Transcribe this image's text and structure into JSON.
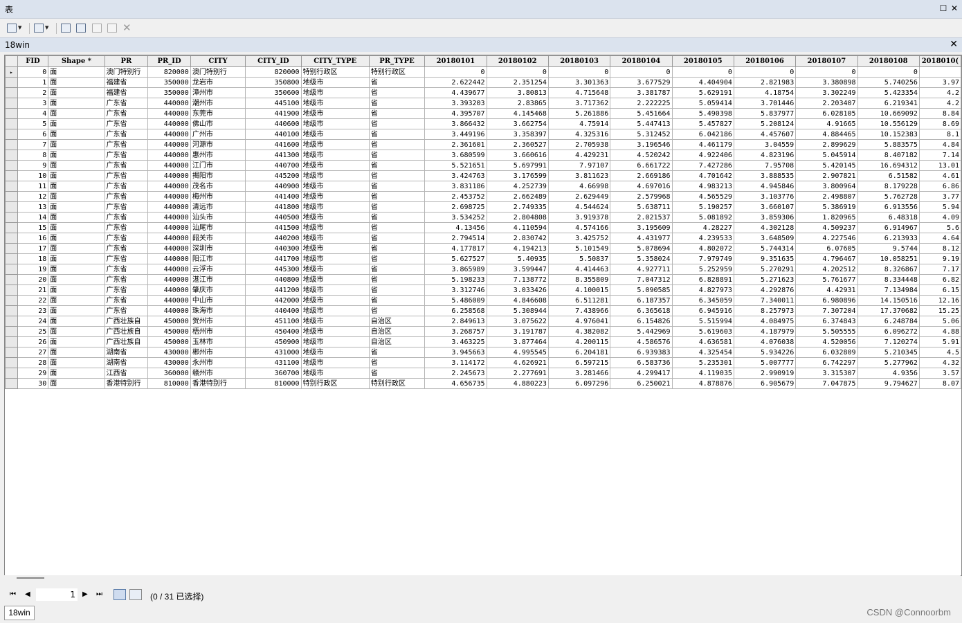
{
  "window": {
    "title": "表"
  },
  "table_tab": {
    "title": "18win"
  },
  "columns": [
    "FID",
    "Shape *",
    "PR",
    "PR_ID",
    "CITY",
    "CITY_ID",
    "CITY_TYPE",
    "PR_TYPE",
    "20180101",
    "20180102",
    "20180103",
    "20180104",
    "20180105",
    "20180106",
    "20180107",
    "20180108",
    "2018010("
  ],
  "rows": [
    [
      "0",
      "面",
      "澳门特别行",
      "820000",
      "澳门特别行",
      "820000",
      "特别行政区",
      "特别行政区",
      "0",
      "0",
      "0",
      "0",
      "0",
      "0",
      "0",
      "0",
      ""
    ],
    [
      "1",
      "面",
      "福建省",
      "350000",
      "龙岩市",
      "350800",
      "地级市",
      "省",
      "2.622442",
      "2.351254",
      "3.301363",
      "3.677529",
      "4.404904",
      "2.821983",
      "3.380898",
      "5.740256",
      "3.97"
    ],
    [
      "2",
      "面",
      "福建省",
      "350000",
      "漳州市",
      "350600",
      "地级市",
      "省",
      "4.439677",
      "3.80813",
      "4.715648",
      "3.381787",
      "5.629191",
      "4.18754",
      "3.302249",
      "5.423354",
      "4.2"
    ],
    [
      "3",
      "面",
      "广东省",
      "440000",
      "潮州市",
      "445100",
      "地级市",
      "省",
      "3.393203",
      "2.83865",
      "3.717362",
      "2.222225",
      "5.059414",
      "3.701446",
      "2.203407",
      "6.219341",
      "4.2"
    ],
    [
      "4",
      "面",
      "广东省",
      "440000",
      "东莞市",
      "441900",
      "地级市",
      "省",
      "4.395707",
      "4.145468",
      "5.261886",
      "5.451664",
      "5.490398",
      "5.837977",
      "6.028105",
      "10.669092",
      "8.84"
    ],
    [
      "5",
      "面",
      "广东省",
      "440000",
      "佛山市",
      "440600",
      "地级市",
      "省",
      "3.866432",
      "3.662754",
      "4.75914",
      "5.447413",
      "5.457827",
      "5.208124",
      "4.91665",
      "10.556129",
      "8.69"
    ],
    [
      "6",
      "面",
      "广东省",
      "440000",
      "广州市",
      "440100",
      "地级市",
      "省",
      "3.449196",
      "3.358397",
      "4.325316",
      "5.312452",
      "6.042186",
      "4.457607",
      "4.884465",
      "10.152383",
      "8.1"
    ],
    [
      "7",
      "面",
      "广东省",
      "440000",
      "河源市",
      "441600",
      "地级市",
      "省",
      "2.361601",
      "2.360527",
      "2.705938",
      "3.196546",
      "4.461179",
      "3.04559",
      "2.899629",
      "5.883575",
      "4.84"
    ],
    [
      "8",
      "面",
      "广东省",
      "440000",
      "惠州市",
      "441300",
      "地级市",
      "省",
      "3.680599",
      "3.660616",
      "4.429231",
      "4.520242",
      "4.922406",
      "4.823196",
      "5.045914",
      "8.407182",
      "7.14"
    ],
    [
      "9",
      "面",
      "广东省",
      "440000",
      "江门市",
      "440700",
      "地级市",
      "省",
      "5.521651",
      "5.697991",
      "7.97107",
      "6.661722",
      "7.427286",
      "7.95708",
      "5.420145",
      "16.694312",
      "13.01"
    ],
    [
      "10",
      "面",
      "广东省",
      "440000",
      "揭阳市",
      "445200",
      "地级市",
      "省",
      "3.424763",
      "3.176599",
      "3.811623",
      "2.669186",
      "4.701642",
      "3.888535",
      "2.907821",
      "6.51582",
      "4.61"
    ],
    [
      "11",
      "面",
      "广东省",
      "440000",
      "茂名市",
      "440900",
      "地级市",
      "省",
      "3.831186",
      "4.252739",
      "4.66998",
      "4.697016",
      "4.983213",
      "4.945846",
      "3.800964",
      "8.179228",
      "6.86"
    ],
    [
      "12",
      "面",
      "广东省",
      "440000",
      "梅州市",
      "441400",
      "地级市",
      "省",
      "2.453752",
      "2.662489",
      "2.629449",
      "2.579968",
      "4.565529",
      "3.103776",
      "2.498807",
      "5.762728",
      "3.77"
    ],
    [
      "13",
      "面",
      "广东省",
      "440000",
      "清远市",
      "441800",
      "地级市",
      "省",
      "2.698725",
      "2.749335",
      "4.544624",
      "5.638711",
      "5.190257",
      "3.660107",
      "5.386919",
      "6.913556",
      "5.94"
    ],
    [
      "14",
      "面",
      "广东省",
      "440000",
      "汕头市",
      "440500",
      "地级市",
      "省",
      "3.534252",
      "2.804808",
      "3.919378",
      "2.021537",
      "5.081892",
      "3.859306",
      "1.820965",
      "6.48318",
      "4.09"
    ],
    [
      "15",
      "面",
      "广东省",
      "440000",
      "汕尾市",
      "441500",
      "地级市",
      "省",
      "4.13456",
      "4.110594",
      "4.574166",
      "3.195609",
      "4.28227",
      "4.302128",
      "4.509237",
      "6.914967",
      "5.6"
    ],
    [
      "16",
      "面",
      "广东省",
      "440000",
      "韶关市",
      "440200",
      "地级市",
      "省",
      "2.794514",
      "2.830742",
      "3.425752",
      "4.431977",
      "4.239533",
      "3.648509",
      "4.227546",
      "6.213933",
      "4.64"
    ],
    [
      "17",
      "面",
      "广东省",
      "440000",
      "深圳市",
      "440300",
      "地级市",
      "省",
      "4.177817",
      "4.194213",
      "5.101549",
      "5.078694",
      "4.802072",
      "5.744314",
      "6.07605",
      "9.5744",
      "8.12"
    ],
    [
      "18",
      "面",
      "广东省",
      "440000",
      "阳江市",
      "441700",
      "地级市",
      "省",
      "5.627527",
      "5.40935",
      "5.50837",
      "5.358024",
      "7.979749",
      "9.351635",
      "4.796467",
      "10.058251",
      "9.19"
    ],
    [
      "19",
      "面",
      "广东省",
      "440000",
      "云浮市",
      "445300",
      "地级市",
      "省",
      "3.865989",
      "3.599447",
      "4.414463",
      "4.927711",
      "5.252959",
      "5.270291",
      "4.202512",
      "8.326867",
      "7.17"
    ],
    [
      "20",
      "面",
      "广东省",
      "440000",
      "湛江市",
      "440800",
      "地级市",
      "省",
      "5.198233",
      "7.138772",
      "8.355809",
      "7.047312",
      "6.828891",
      "5.271623",
      "5.761677",
      "8.334448",
      "6.82"
    ],
    [
      "21",
      "面",
      "广东省",
      "440000",
      "肇庆市",
      "441200",
      "地级市",
      "省",
      "3.312746",
      "3.033426",
      "4.100015",
      "5.090585",
      "4.827973",
      "4.292876",
      "4.42931",
      "7.134984",
      "6.15"
    ],
    [
      "22",
      "面",
      "广东省",
      "440000",
      "中山市",
      "442000",
      "地级市",
      "省",
      "5.486009",
      "4.846608",
      "6.511281",
      "6.187357",
      "6.345059",
      "7.340011",
      "6.980896",
      "14.150516",
      "12.16"
    ],
    [
      "23",
      "面",
      "广东省",
      "440000",
      "珠海市",
      "440400",
      "地级市",
      "省",
      "6.258568",
      "5.308944",
      "7.438966",
      "6.365618",
      "6.945916",
      "8.257973",
      "7.307204",
      "17.370682",
      "15.25"
    ],
    [
      "24",
      "面",
      "广西壮族自",
      "450000",
      "贺州市",
      "451100",
      "地级市",
      "自治区",
      "2.849613",
      "3.075622",
      "4.976041",
      "6.154826",
      "5.515994",
      "4.084975",
      "6.374843",
      "6.248784",
      "5.06"
    ],
    [
      "25",
      "面",
      "广西壮族自",
      "450000",
      "梧州市",
      "450400",
      "地级市",
      "自治区",
      "3.268757",
      "3.191787",
      "4.382082",
      "5.442969",
      "5.619603",
      "4.187979",
      "5.505555",
      "6.096272",
      "4.88"
    ],
    [
      "26",
      "面",
      "广西壮族自",
      "450000",
      "玉林市",
      "450900",
      "地级市",
      "自治区",
      "3.463225",
      "3.877464",
      "4.200115",
      "4.586576",
      "4.636581",
      "4.076038",
      "4.520056",
      "7.120274",
      "5.91"
    ],
    [
      "27",
      "面",
      "湖南省",
      "430000",
      "郴州市",
      "431000",
      "地级市",
      "省",
      "3.945663",
      "4.995545",
      "6.204181",
      "6.939383",
      "4.325454",
      "5.934226",
      "6.032809",
      "5.210345",
      "4.5"
    ],
    [
      "28",
      "面",
      "湖南省",
      "430000",
      "永州市",
      "431100",
      "地级市",
      "省",
      "3.114172",
      "4.626921",
      "6.597215",
      "6.583736",
      "5.235301",
      "5.007777",
      "6.742297",
      "5.277962",
      "4.32"
    ],
    [
      "29",
      "面",
      "江西省",
      "360000",
      "赣州市",
      "360700",
      "地级市",
      "省",
      "2.245673",
      "2.277691",
      "3.281466",
      "4.299417",
      "4.119035",
      "2.990919",
      "3.315307",
      "4.9356",
      "3.57"
    ],
    [
      "30",
      "面",
      "香港特别行",
      "810000",
      "香港特别行",
      "810000",
      "特别行政区",
      "特别行政区",
      "4.656735",
      "4.880223",
      "6.097296",
      "6.250021",
      "4.878876",
      "6.905679",
      "7.047875",
      "9.794627",
      "8.07"
    ]
  ],
  "nav": {
    "first": "⏮",
    "prev": "◀",
    "page": "1",
    "next": "▶",
    "last": "⏭",
    "selection": "(0 / 31 已选择)"
  },
  "bottom_tab": "18win",
  "watermark": "CSDN @Connoorbm"
}
